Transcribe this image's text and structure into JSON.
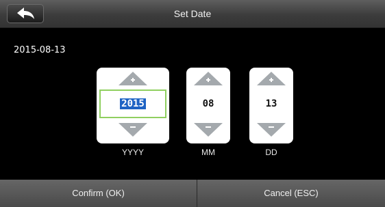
{
  "header": {
    "title": "Set Date",
    "back_icon": "back-arrow-icon"
  },
  "current_date": "2015-08-13",
  "pickers": [
    {
      "value": "2015",
      "unit": "YYYY",
      "selected": true
    },
    {
      "value": "08",
      "unit": "MM",
      "selected": false
    },
    {
      "value": "13",
      "unit": "DD",
      "selected": false
    }
  ],
  "footer": {
    "confirm_label": "Confirm (OK)",
    "cancel_label": "Cancel (ESC)"
  },
  "colors": {
    "selection_border": "#8fcf5f",
    "selection_fill": "#1e63c4",
    "arrow": "#9aa0a4"
  }
}
